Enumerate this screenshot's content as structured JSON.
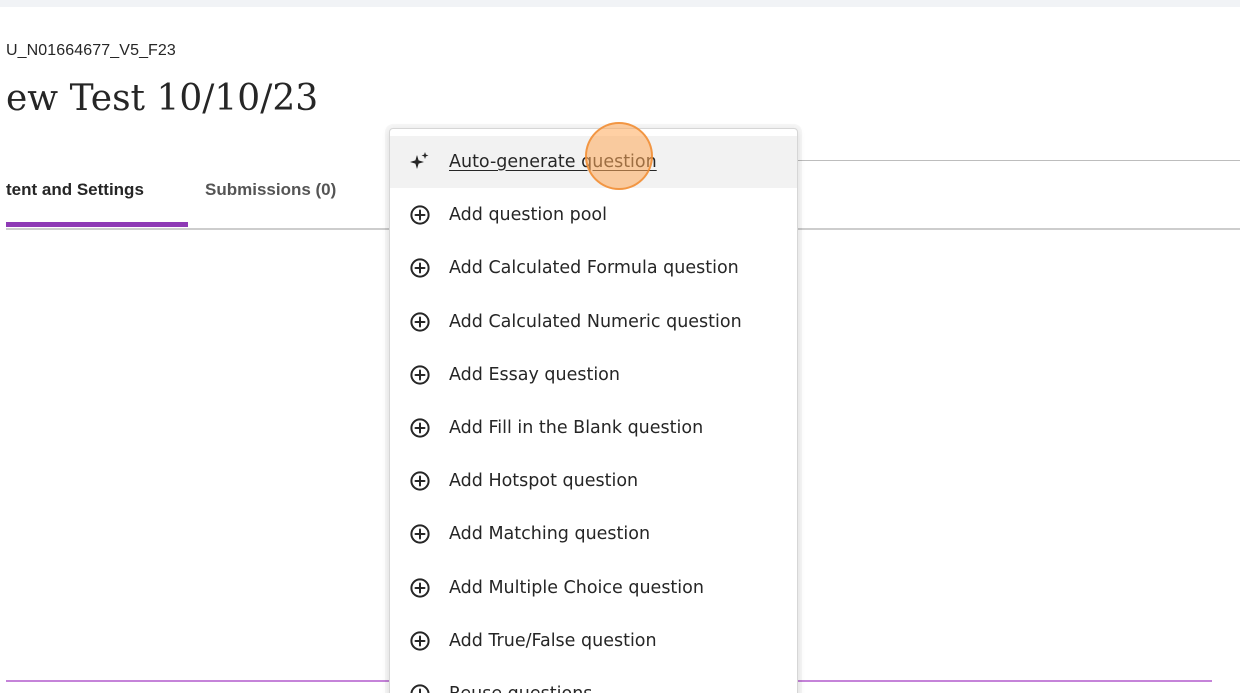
{
  "course": {
    "id": "U_N01664677_V5_F23"
  },
  "page": {
    "title": "ew Test 10/10/23"
  },
  "tabs": [
    {
      "label": "tent and Settings",
      "active": true
    },
    {
      "label": "Submissions (0)",
      "active": false
    }
  ],
  "menu": {
    "items": [
      {
        "label": "Auto-generate question",
        "icon": "sparkle-icon",
        "hover": true
      },
      {
        "label": "Add question pool",
        "icon": "plus-circle-icon"
      },
      {
        "label": "Add Calculated Formula question",
        "icon": "plus-circle-icon"
      },
      {
        "label": "Add Calculated Numeric question",
        "icon": "plus-circle-icon"
      },
      {
        "label": "Add Essay question",
        "icon": "plus-circle-icon"
      },
      {
        "label": "Add Fill in the Blank question",
        "icon": "plus-circle-icon"
      },
      {
        "label": "Add Hotspot question",
        "icon": "plus-circle-icon"
      },
      {
        "label": "Add Matching question",
        "icon": "plus-circle-icon"
      },
      {
        "label": "Add Multiple Choice question",
        "icon": "plus-circle-icon"
      },
      {
        "label": "Add True/False question",
        "icon": "plus-circle-icon"
      },
      {
        "label": "Reuse questions",
        "icon": "plus-circle-icon"
      }
    ]
  },
  "colors": {
    "accent": "#8e3ab5",
    "bottom_accent": "#c583d9",
    "cursor_highlight": "#ffaa5a"
  }
}
